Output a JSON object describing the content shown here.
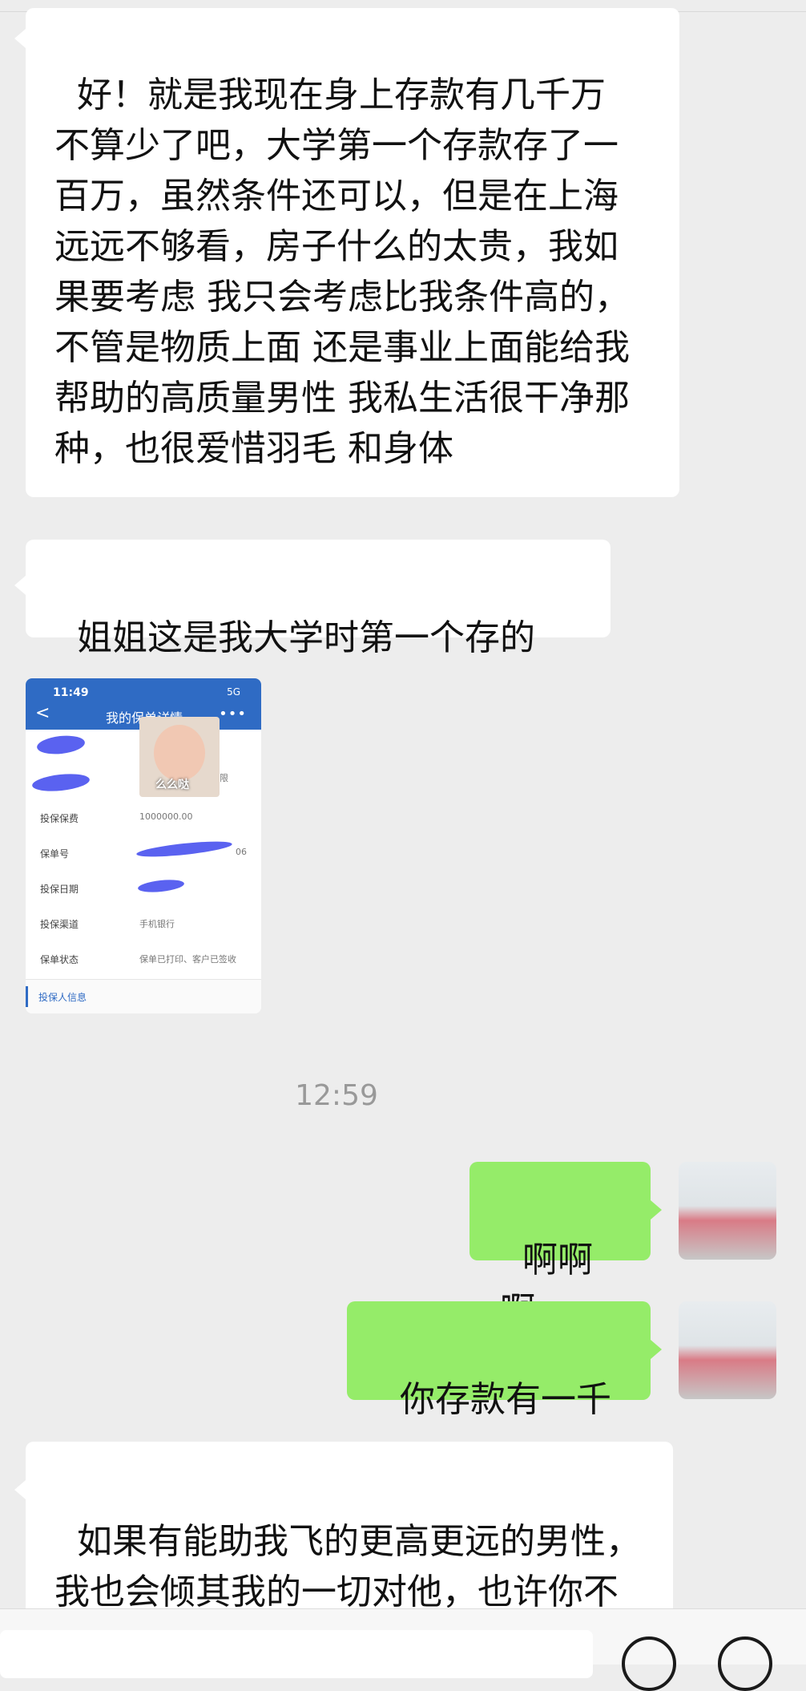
{
  "messages": {
    "m1": "好！就是我现在身上存款有几千万 不算少了吧，大学第一个存款存了一百万，虽然条件还可以，但是在上海远远不够看，房子什么的太贵，我如果要考虑 我只会考虑比我条件高的，不管是物质上面 还是事业上面能给我帮助的高质量男性 我私生活很干净那种，也很爱惜羽毛 和身体",
    "m2": "姐姐这是我大学时第一个存的",
    "m4": "啊啊啊",
    "m5": "你存款有一千",
    "m6": "如果有能助我飞的更高更远的男性，我也会倾其我的一切对他，也许你不会相信，我的第一次还"
  },
  "timestamp": "12:59",
  "shot": {
    "status_time": "11:49",
    "signal": "5G",
    "title": "我的保单详情",
    "sticker_caption": "么么哒",
    "extra": "限",
    "rows": [
      {
        "label": "投保保费",
        "value": "1000000.00"
      },
      {
        "label": "保单号",
        "value": "06"
      },
      {
        "label": "投保日期",
        "value": ""
      },
      {
        "label": "投保渠道",
        "value": "手机银行"
      },
      {
        "label": "保单状态",
        "value": "保单已打印、客户已签收"
      }
    ],
    "footer": "投保人信息"
  },
  "colors": {
    "background": "#ededed",
    "bubble_left": "#ffffff",
    "bubble_right": "#95ec69",
    "app_blue": "#2f6bc4",
    "redaction": "#5a62f0"
  }
}
